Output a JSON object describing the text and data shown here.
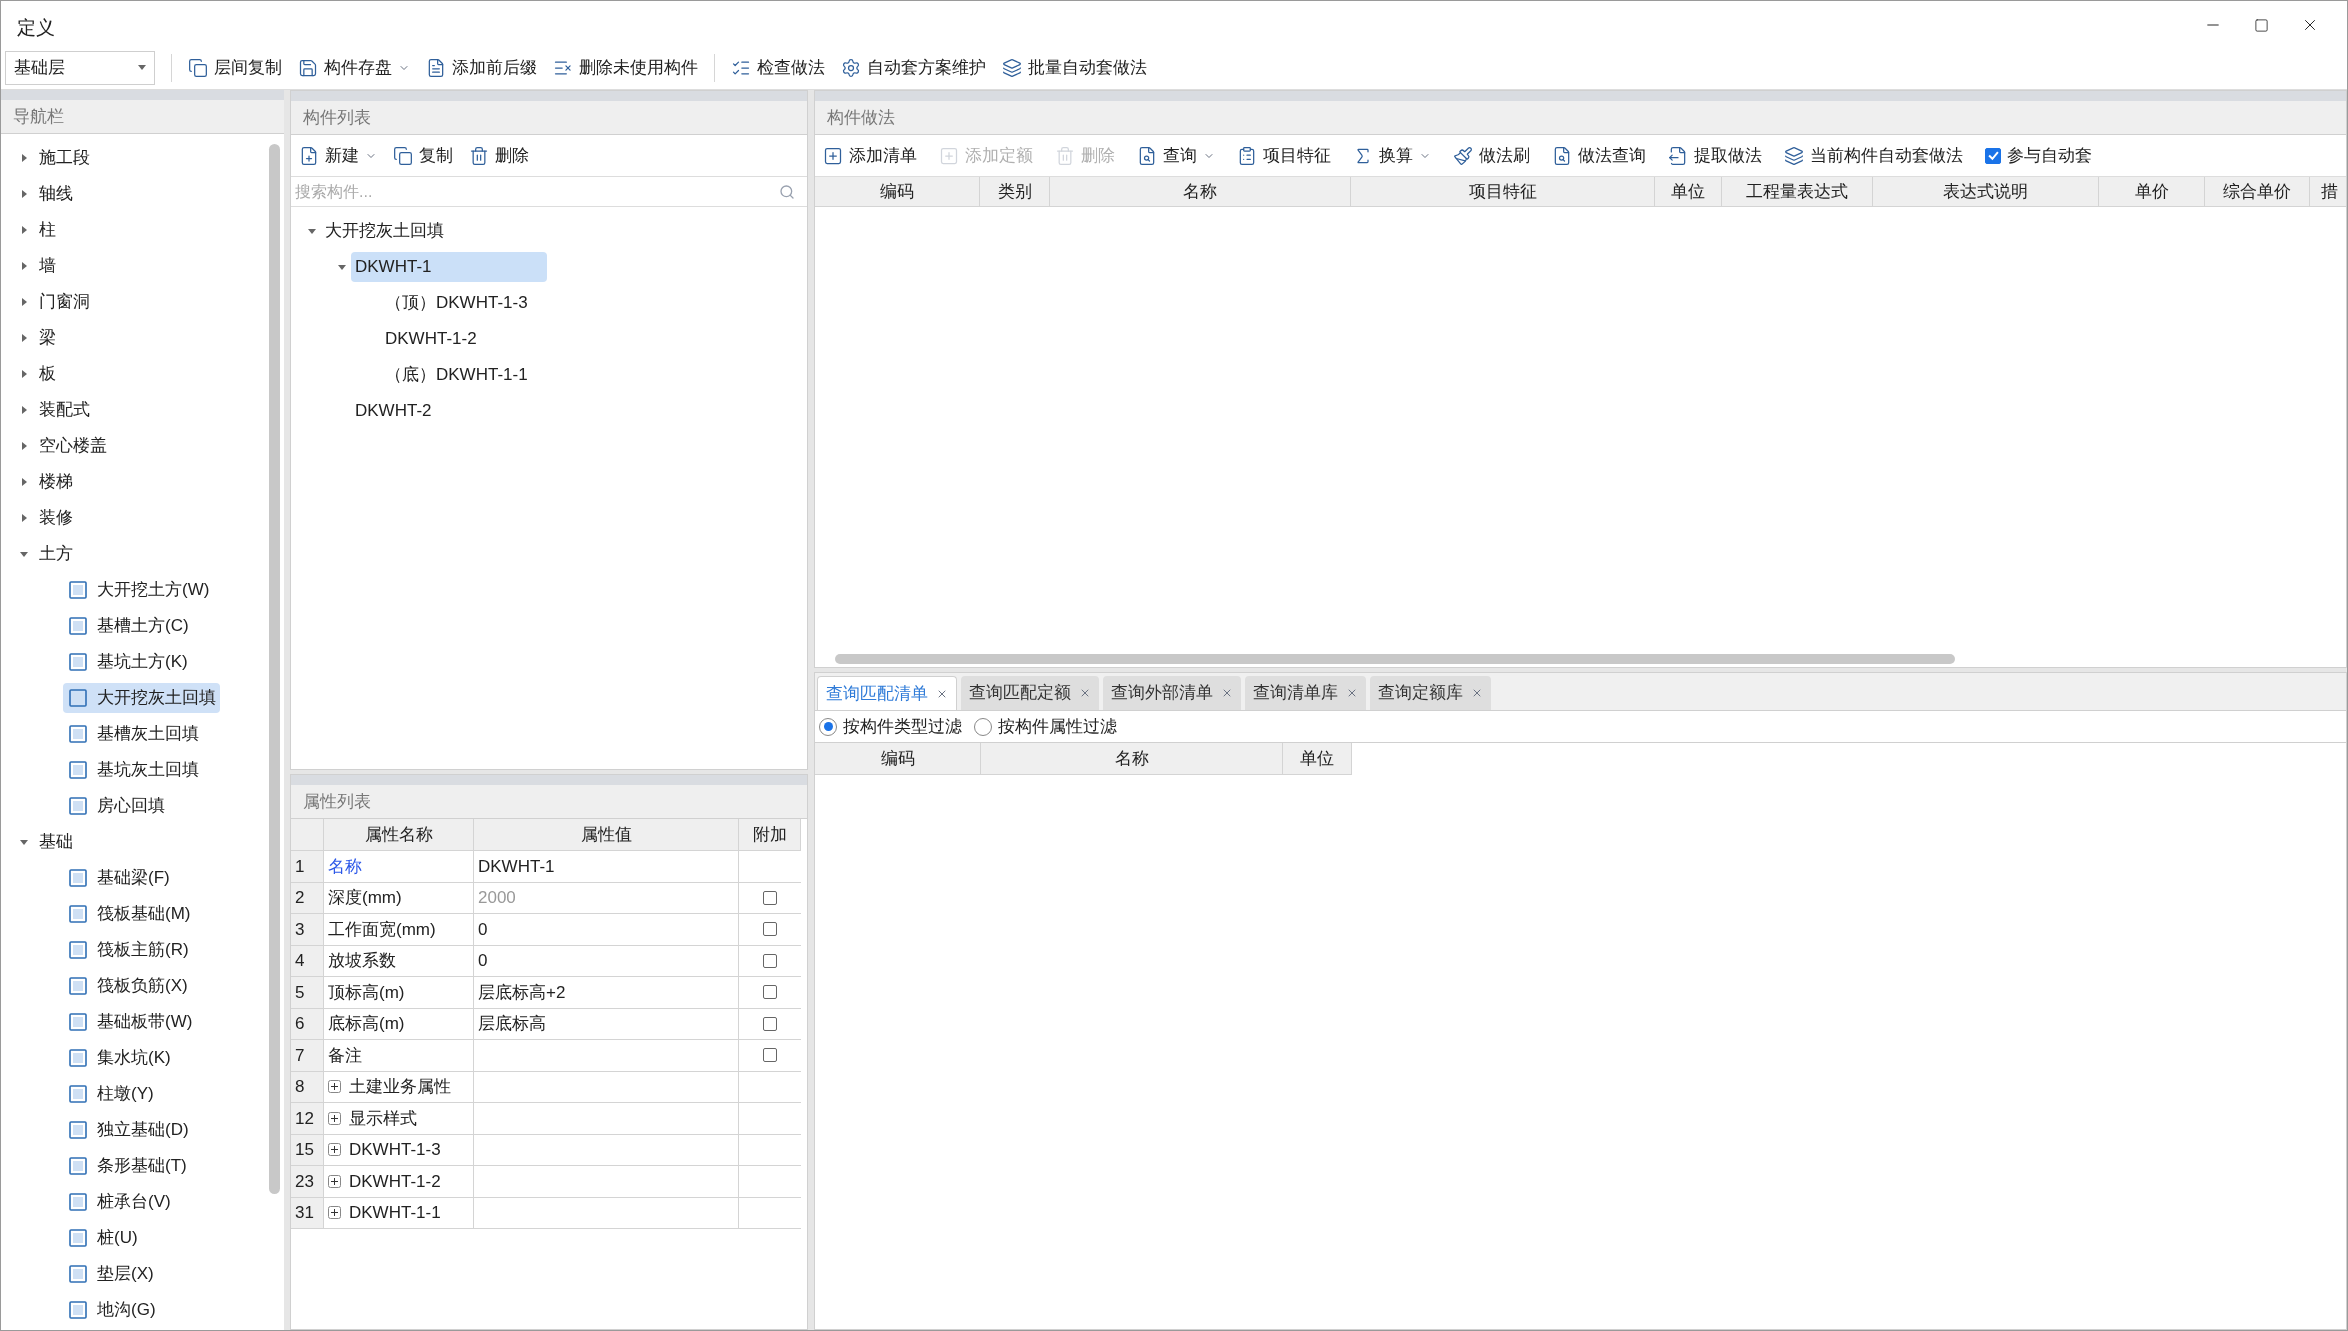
{
  "window": {
    "title": "定义"
  },
  "toolbar": {
    "floor_select": "基础层",
    "buttons": [
      {
        "label": "层间复制",
        "kind": "copy",
        "dropdown": false
      },
      {
        "label": "构件存盘",
        "kind": "save",
        "dropdown": true
      },
      {
        "label": "添加前后缀",
        "kind": "text",
        "dropdown": false
      },
      {
        "label": "删除未使用构件",
        "kind": "remove",
        "dropdown": false
      },
      {
        "label": "检查做法",
        "kind": "check",
        "dropdown": false
      },
      {
        "label": "自动套方案维护",
        "kind": "gear",
        "dropdown": false
      },
      {
        "label": "批量自动套做法",
        "kind": "layers",
        "dropdown": false
      }
    ]
  },
  "nav": {
    "title": "导航栏",
    "items": [
      {
        "label": "施工段",
        "expanded": false
      },
      {
        "label": "轴线",
        "expanded": false
      },
      {
        "label": "柱",
        "expanded": false
      },
      {
        "label": "墙",
        "expanded": false
      },
      {
        "label": "门窗洞",
        "expanded": false
      },
      {
        "label": "梁",
        "expanded": false
      },
      {
        "label": "板",
        "expanded": false
      },
      {
        "label": "装配式",
        "expanded": false
      },
      {
        "label": "空心楼盖",
        "expanded": false
      },
      {
        "label": "楼梯",
        "expanded": false
      },
      {
        "label": "装修",
        "expanded": false
      },
      {
        "label": "土方",
        "expanded": true,
        "children": [
          {
            "label": "大开挖土方(W)",
            "selected": false
          },
          {
            "label": "基槽土方(C)",
            "selected": false
          },
          {
            "label": "基坑土方(K)",
            "selected": false
          },
          {
            "label": "大开挖灰土回填",
            "selected": true
          },
          {
            "label": "基槽灰土回填",
            "selected": false
          },
          {
            "label": "基坑灰土回填",
            "selected": false
          },
          {
            "label": "房心回填",
            "selected": false
          }
        ]
      },
      {
        "label": "基础",
        "expanded": true,
        "children": [
          {
            "label": "基础梁(F)",
            "selected": false
          },
          {
            "label": "筏板基础(M)",
            "selected": false
          },
          {
            "label": "筏板主筋(R)",
            "selected": false
          },
          {
            "label": "筏板负筋(X)",
            "selected": false
          },
          {
            "label": "基础板带(W)",
            "selected": false
          },
          {
            "label": "集水坑(K)",
            "selected": false
          },
          {
            "label": "柱墩(Y)",
            "selected": false
          },
          {
            "label": "独立基础(D)",
            "selected": false
          },
          {
            "label": "条形基础(T)",
            "selected": false
          },
          {
            "label": "桩承台(V)",
            "selected": false
          },
          {
            "label": "桩(U)",
            "selected": false
          },
          {
            "label": "垫层(X)",
            "selected": false
          },
          {
            "label": "地沟(G)",
            "selected": false
          }
        ]
      }
    ]
  },
  "component_list": {
    "title": "构件列表",
    "toolbar": [
      {
        "label": "新建",
        "kind": "new",
        "dropdown": true
      },
      {
        "label": "复制",
        "kind": "copy",
        "dropdown": false
      },
      {
        "label": "删除",
        "kind": "delete",
        "dropdown": false
      }
    ],
    "search": {
      "placeholder": "搜索构件..."
    },
    "tree": [
      {
        "label": "大开挖灰土回填",
        "expanded": true,
        "selected": false,
        "children": [
          {
            "label": "DKWHT-1",
            "expanded": true,
            "selected": true,
            "children": [
              {
                "label": "（顶）DKWHT-1-3",
                "selected": false
              },
              {
                "label": "DKWHT-1-2",
                "selected": false
              },
              {
                "label": "（底）DKWHT-1-1",
                "selected": false
              }
            ]
          },
          {
            "label": "DKWHT-2",
            "selected": false
          }
        ]
      }
    ]
  },
  "properties": {
    "title": "属性列表",
    "columns": [
      "属性名称",
      "属性值",
      "附加"
    ],
    "rows": [
      {
        "num": "1",
        "kind": "field",
        "name": "名称",
        "highlight": true,
        "value": "DKWHT-1",
        "disabled": false
      },
      {
        "num": "2",
        "kind": "field",
        "name": "深度(mm)",
        "highlight": false,
        "value": "2000",
        "disabled": true,
        "checked": false
      },
      {
        "num": "3",
        "kind": "field",
        "name": "工作面宽(mm)",
        "highlight": false,
        "value": "0",
        "disabled": false,
        "checked": false
      },
      {
        "num": "4",
        "kind": "field",
        "name": "放坡系数",
        "highlight": false,
        "value": "0",
        "disabled": false,
        "checked": false
      },
      {
        "num": "5",
        "kind": "field",
        "name": "顶标高(m)",
        "highlight": false,
        "value": "层底标高+2",
        "disabled": false,
        "checked": false
      },
      {
        "num": "6",
        "kind": "field",
        "name": "底标高(m)",
        "highlight": false,
        "value": "层底标高",
        "disabled": false,
        "checked": false
      },
      {
        "num": "7",
        "kind": "field",
        "name": "备注",
        "highlight": false,
        "checked": false
      },
      {
        "num": "8",
        "kind": "group",
        "name": "土建业务属性",
        "expanded": false
      },
      {
        "num": "12",
        "kind": "group",
        "name": "显示样式",
        "expanded": false
      },
      {
        "num": "15",
        "kind": "group",
        "name": "DKWHT-1-3",
        "expanded": false
      },
      {
        "num": "23",
        "kind": "group",
        "name": "DKWHT-1-2",
        "expanded": false
      },
      {
        "num": "31",
        "kind": "group",
        "name": "DKWHT-1-1",
        "expanded": false
      }
    ]
  },
  "methods": {
    "title": "构件做法",
    "toolbar": [
      {
        "label": "添加清单",
        "kind": "add",
        "disabled": false,
        "dropdown": false
      },
      {
        "label": "添加定额",
        "kind": "add",
        "disabled": true,
        "dropdown": false
      },
      {
        "label": "删除",
        "kind": "delete",
        "disabled": true,
        "dropdown": false
      },
      {
        "label": "查询",
        "kind": "search",
        "disabled": false,
        "dropdown": true
      },
      {
        "label": "项目特征",
        "kind": "list",
        "disabled": false,
        "dropdown": false
      },
      {
        "label": "换算",
        "kind": "fx",
        "disabled": false,
        "dropdown": true
      },
      {
        "label": "做法刷",
        "kind": "brush",
        "disabled": false,
        "dropdown": false
      },
      {
        "label": "做法查询",
        "kind": "search",
        "disabled": false,
        "dropdown": false
      },
      {
        "label": "提取做法",
        "kind": "pick",
        "disabled": false,
        "dropdown": false
      },
      {
        "label": "当前构件自动套做法",
        "kind": "layers",
        "disabled": false,
        "dropdown": false
      }
    ],
    "auto_match": {
      "label": "参与自动套",
      "checked": true
    },
    "columns": [
      "编码",
      "类别",
      "名称",
      "项目特征",
      "单位",
      "工程量表达式",
      "表达式说明",
      "单价",
      "综合单价",
      "措"
    ]
  },
  "query": {
    "tabs": [
      {
        "label": "查询匹配清单",
        "selected": true
      },
      {
        "label": "查询匹配定额",
        "selected": false
      },
      {
        "label": "查询外部清单",
        "selected": false
      },
      {
        "label": "查询清单库",
        "selected": false
      },
      {
        "label": "查询定额库",
        "selected": false
      }
    ],
    "filters": [
      {
        "label": "按构件类型过滤",
        "selected": true
      },
      {
        "label": "按构件属性过滤",
        "selected": false
      }
    ],
    "columns": [
      "编码",
      "名称",
      "单位"
    ]
  }
}
